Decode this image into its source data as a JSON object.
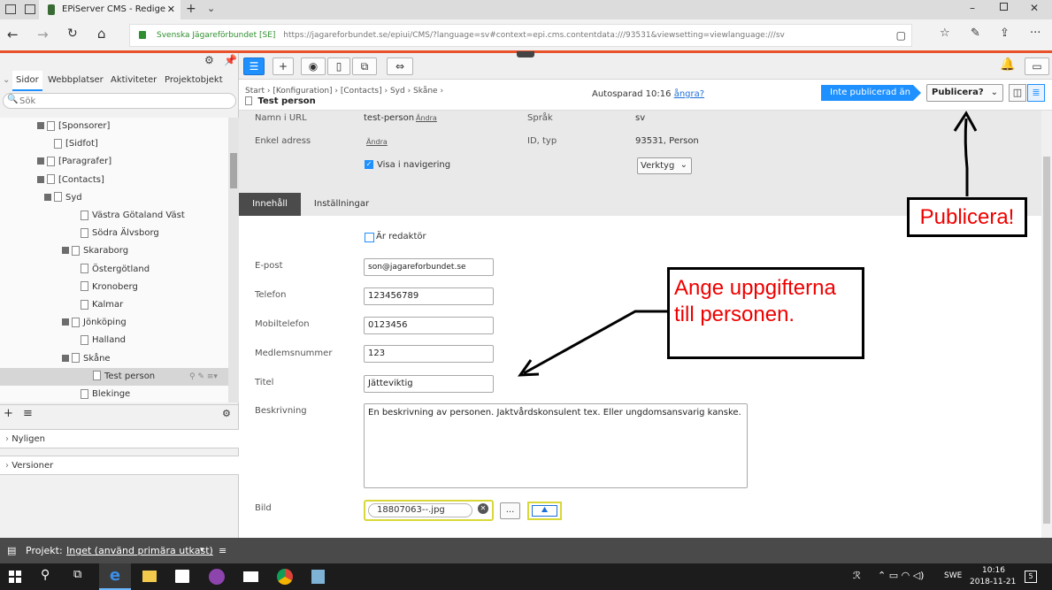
{
  "browser": {
    "tab_title": "EPiServer CMS - Redige",
    "site_name": "Svenska Jägareförbundet [SE]",
    "url": "https://jagareforbundet.se/epiui/CMS/?language=sv#context=epi.cms.contentdata:///93531&viewsetting=viewlanguage:///sv"
  },
  "left": {
    "tabs": [
      "Sidor",
      "Webbplatser",
      "Aktiviteter",
      "Projektobjekt"
    ],
    "search_placeholder": "Sök",
    "tree": [
      {
        "label": "[Sponsorer]",
        "indent": 0,
        "exp": true
      },
      {
        "label": "[Sidfot]",
        "indent": 1,
        "exp": false
      },
      {
        "label": "[Paragrafer]",
        "indent": 0,
        "exp": true
      },
      {
        "label": "[Contacts]",
        "indent": 0,
        "exp": true
      },
      {
        "label": "Syd",
        "indent": 1,
        "exp": true
      },
      {
        "label": "Västra Götaland Väst",
        "indent": 3,
        "exp": false
      },
      {
        "label": "Södra Älvsborg",
        "indent": 3,
        "exp": false
      },
      {
        "label": "Skaraborg",
        "indent": 2,
        "exp": true
      },
      {
        "label": "Östergötland",
        "indent": 3,
        "exp": false
      },
      {
        "label": "Kronoberg",
        "indent": 3,
        "exp": false
      },
      {
        "label": "Kalmar",
        "indent": 3,
        "exp": false
      },
      {
        "label": "Jönköping",
        "indent": 2,
        "exp": true
      },
      {
        "label": "Halland",
        "indent": 3,
        "exp": false
      },
      {
        "label": "Skåne",
        "indent": 2,
        "exp": true
      },
      {
        "label": "Test person",
        "indent": 4,
        "exp": false,
        "selected": true
      },
      {
        "label": "Blekinge",
        "indent": 3,
        "exp": false
      }
    ],
    "recent": "Nyligen",
    "versions": "Versioner"
  },
  "header": {
    "breadcrumb": [
      "Start",
      "[Konfiguration]",
      "[Contacts]",
      "Syd",
      "Skåne"
    ],
    "page_title": "Test person",
    "autosave": "Autosparad 10:16",
    "undo": "ångra?",
    "status_badge": "Inte publicerad än",
    "publish_button": "Publicera?"
  },
  "meta": {
    "name_url_label": "Namn i URL",
    "name_url_value": "test-person",
    "change_link": "Ändra",
    "simple_address_label": "Enkel adress",
    "simple_address_link": "Ändra",
    "show_in_nav": "Visa i navigering",
    "language_label": "Språk",
    "language_value": "sv",
    "id_type_label": "ID, typ",
    "id_type_value": "93531, Person",
    "tools_button": "Verktyg"
  },
  "content_tabs": [
    "Innehåll",
    "Inställningar"
  ],
  "form": {
    "editor_checkbox": "Är redaktör",
    "email_label": "E-post",
    "email_value": "son@jagareforbundet.se",
    "phone_label": "Telefon",
    "phone_value": "123456789",
    "mobile_label": "Mobiltelefon",
    "mobile_value": "0123456",
    "member_label": "Medlemsnummer",
    "member_value": "123",
    "title_label": "Titel",
    "title_value": "Jätteviktig",
    "description_label": "Beskrivning",
    "description_value": "En beskrivning av personen. Jaktvårdskonsulent tex. Eller ungdomsansvarig kanske.",
    "image_label": "Bild",
    "image_value": "18807063--.jpg",
    "browse_button": "..."
  },
  "annotations": {
    "publish_callout": "Publicera!",
    "fill_callout_line1": "Ange uppgifterna",
    "fill_callout_line2": "till personen."
  },
  "project_bar": {
    "label": "Projekt:",
    "value": "Inget (använd primära utkast)"
  },
  "taskbar": {
    "lang": "SWE",
    "time": "10:16",
    "date": "2018-11-21",
    "notif_count": "5"
  },
  "colors": {
    "accent": "#1e90ff",
    "brand_red": "#e8512a",
    "annotation_red": "#e00000"
  }
}
